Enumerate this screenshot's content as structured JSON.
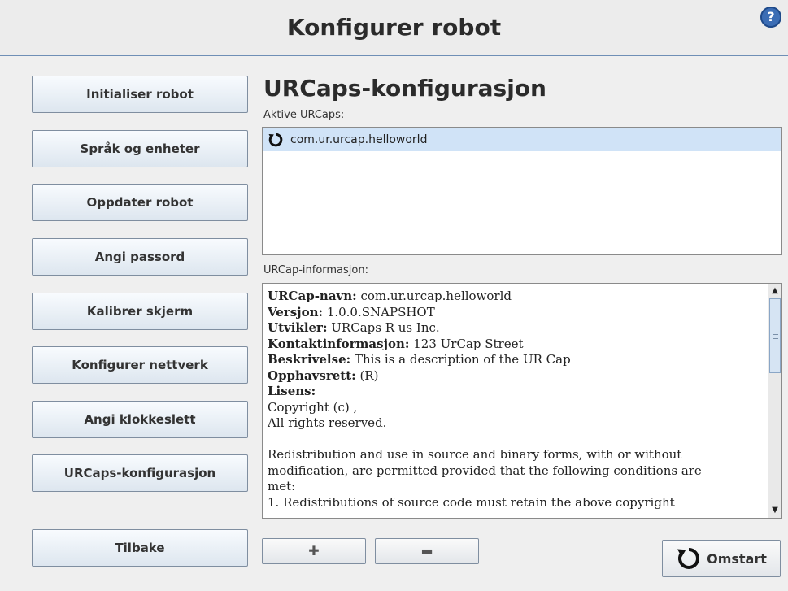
{
  "header": {
    "title": "Konfigurer robot",
    "help_icon": "?"
  },
  "nav": [
    "Initialiser robot",
    "Språk og enheter",
    "Oppdater robot",
    "Angi passord",
    "Kalibrer skjerm",
    "Konfigurer nettverk",
    "Angi klokkeslett",
    "URCaps-konfigurasjon"
  ],
  "back_label": "Tilbake",
  "main": {
    "title": "URCaps-konfigurasjon",
    "active_label": "Aktive URCaps:",
    "active_items": [
      {
        "name": "com.ur.urcap.helloworld",
        "icon": "refresh-icon",
        "selected": true
      }
    ],
    "info_label": "URCap-informasjon:",
    "info": {
      "name_label": "URCap-navn:",
      "name_value": "com.ur.urcap.helloworld",
      "version_label": "Versjon:",
      "version_value": "1.0.0.SNAPSHOT",
      "developer_label": "Utvikler:",
      "developer_value": "URCaps R us Inc.",
      "contact_label": "Kontaktinformasjon:",
      "contact_value": "123 UrCap Street",
      "description_label": "Beskrivelse:",
      "description_value": "This is a description of the UR Cap",
      "copyright_label": "Opphavsrett:",
      "copyright_value": "(R)",
      "license_label": "Lisens:",
      "license_lines": [
        "Copyright (c) ,",
        "All rights reserved.",
        "",
        "Redistribution and use in source and binary forms, with or without",
        "modification, are permitted provided that the following conditions are",
        "met:",
        "1. Redistributions of source code must retain the above copyright"
      ]
    },
    "add_symbol": "✚",
    "remove_symbol": "▬",
    "restart_label": "Omstart"
  },
  "colors": {
    "accent": "#3b6db5",
    "selection": "#d0e3f7",
    "header_line": "#6f8fb6"
  }
}
